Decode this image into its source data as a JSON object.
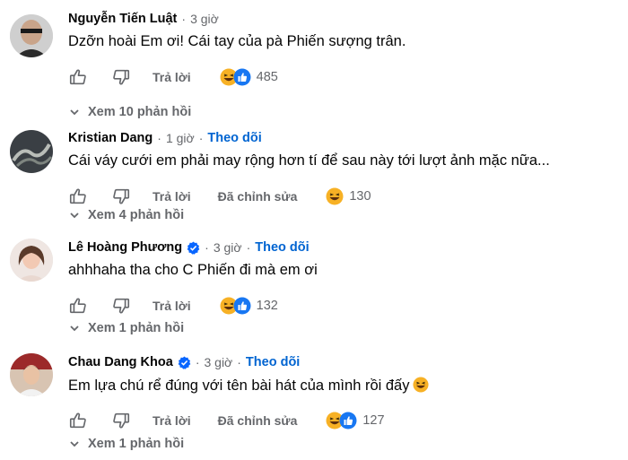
{
  "colors": {
    "link": "#0064d1",
    "muted": "#65676b",
    "verified": "#0866ff"
  },
  "comments": [
    {
      "name": "Nguyễn Tiến Luật",
      "verified": false,
      "dot": "·",
      "time": "3 giờ",
      "follow": "",
      "text": "Dzỡn hoài Em ơi! Cái tay của pà Phiến sượng trân.",
      "reply": "Trả lời",
      "edited": "",
      "reactions": [
        "haha-icon",
        "like-icon"
      ],
      "count": "485",
      "replies": "Xem 10 phản hồi"
    },
    {
      "name": "Kristian Dang",
      "verified": false,
      "dot": "·",
      "time": "1 giờ",
      "follow": "Theo dõi",
      "text": "Cái váy cưới em phải may rộng hơn tí để sau này tới lượt ảnh mặc nữa...",
      "reply": "Trả lời",
      "edited": "Đã chỉnh sửa",
      "reactions": [
        "haha-icon"
      ],
      "count": "130",
      "replies": "Xem 4 phản hồi"
    },
    {
      "name": "Lê Hoàng Phương",
      "verified": true,
      "dot": "·",
      "time": "3 giờ",
      "follow": "Theo dõi",
      "text": "ahhhaha tha cho C Phiến đi mà em ơi",
      "reply": "Trả lời",
      "edited": "",
      "reactions": [
        "haha-icon",
        "like-icon"
      ],
      "count": "132",
      "replies": "Xem 1 phản hồi"
    },
    {
      "name": "Chau Dang Khoa",
      "verified": true,
      "dot": "·",
      "time": "3 giờ",
      "follow": "Theo dõi",
      "text": "Em lựa chú rể đúng với tên bài hát của mình rồi đấy",
      "reply": "Trả lời",
      "edited": "Đã chỉnh sửa",
      "reactions": [
        "haha-icon",
        "like-icon"
      ],
      "count": "127",
      "replies": "Xem 1 phản hồi"
    }
  ]
}
